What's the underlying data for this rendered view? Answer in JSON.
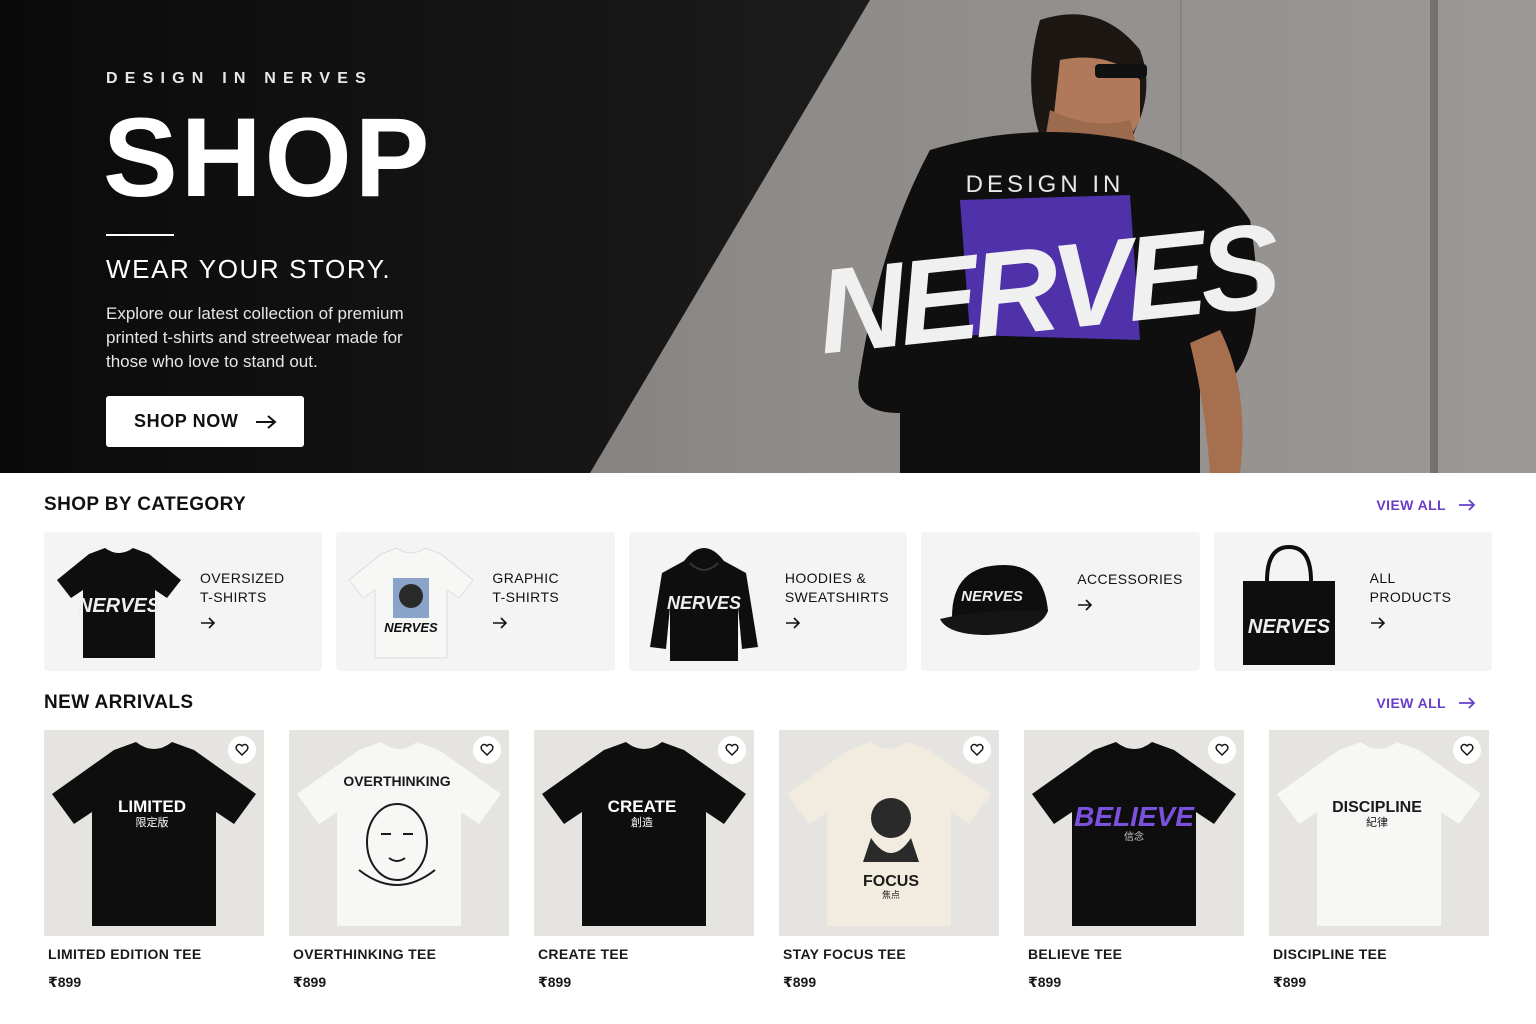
{
  "hero": {
    "eyebrow": "DESIGN IN NERVES",
    "title": "SHOP",
    "tagline": "WEAR YOUR STORY.",
    "description": "Explore our latest collection of premium printed t-shirts and streetwear made for those who love to stand out.",
    "cta_label": "SHOP NOW",
    "shirt_print_top": "DESIGN IN",
    "shirt_print_main": "NERVES"
  },
  "categories": {
    "title": "SHOP BY CATEGORY",
    "view_all": "VIEW ALL",
    "items": [
      {
        "label": "OVERSIZED\nT-SHIRTS",
        "print": "NERVES"
      },
      {
        "label": "GRAPHIC\nT-SHIRTS",
        "print": "NERVES"
      },
      {
        "label": "HOODIES &\nSWEATSHIRTS",
        "print": "NERVES"
      },
      {
        "label": "ACCESSORIES",
        "print": "NERVES"
      },
      {
        "label": "ALL\nPRODUCTS",
        "print": "NERVES"
      }
    ]
  },
  "arrivals": {
    "title": "NEW ARRIVALS",
    "view_all": "VIEW ALL",
    "items": [
      {
        "name": "LIMITED EDITION TEE",
        "price": "₹899",
        "print": "LIMITED",
        "sub": "限定版"
      },
      {
        "name": "OVERTHINKING TEE",
        "price": "₹899",
        "print": "OVERTHINKING",
        "sub": ""
      },
      {
        "name": "CREATE TEE",
        "price": "₹899",
        "print": "CREATE",
        "sub": "創造"
      },
      {
        "name": "STAY FOCUS TEE",
        "price": "₹899",
        "print": "FOCUS",
        "sub": "焦点"
      },
      {
        "name": "BELIEVE TEE",
        "price": "₹899",
        "print": "BELIEVE",
        "sub": "信念"
      },
      {
        "name": "DISCIPLINE TEE",
        "price": "₹899",
        "print": "DISCIPLINE",
        "sub": "紀律"
      }
    ]
  },
  "colors": {
    "accent": "#6a3ec9",
    "shirt_black": "#0e0e0e",
    "shirt_white": "#f7f7f5",
    "shirt_cream": "#f1ecdf",
    "print_purple": "#7b52e0"
  }
}
